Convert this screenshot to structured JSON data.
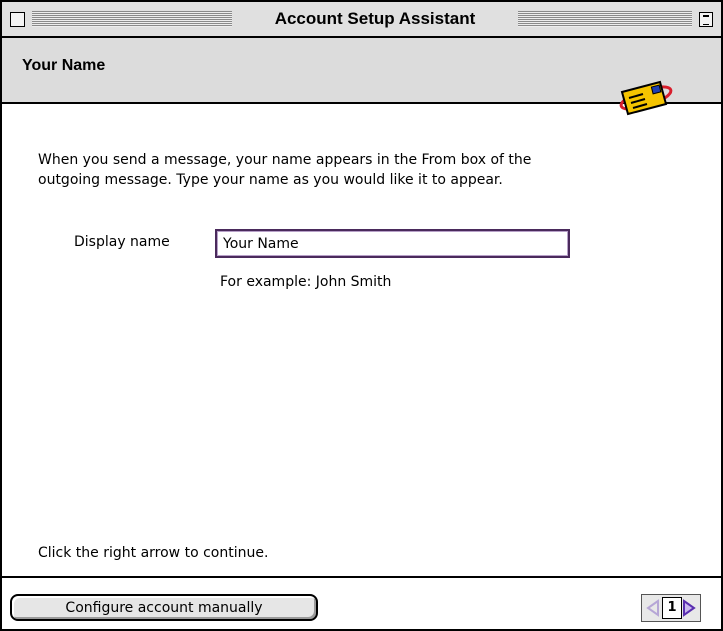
{
  "window": {
    "title": "Account Setup Assistant"
  },
  "header": {
    "title": "Your Name",
    "icon": "postcard-icon"
  },
  "main": {
    "intro_line1": "When you send a message, your name appears in the From box of the",
    "intro_line2": "outgoing message. Type your name as you would like it to appear.",
    "display_name_label": "Display name",
    "display_name_value": "Your Name",
    "example_text": "For example: John Smith",
    "continue_text": "Click the right arrow to continue."
  },
  "footer": {
    "manual_button_label": "Configure account manually",
    "page_number": "1"
  },
  "colors": {
    "input_border": "#4a2a5c",
    "icon_yellow": "#f5c400",
    "icon_red": "#d81e2c",
    "arrow_purple": "#8a5fd0"
  }
}
